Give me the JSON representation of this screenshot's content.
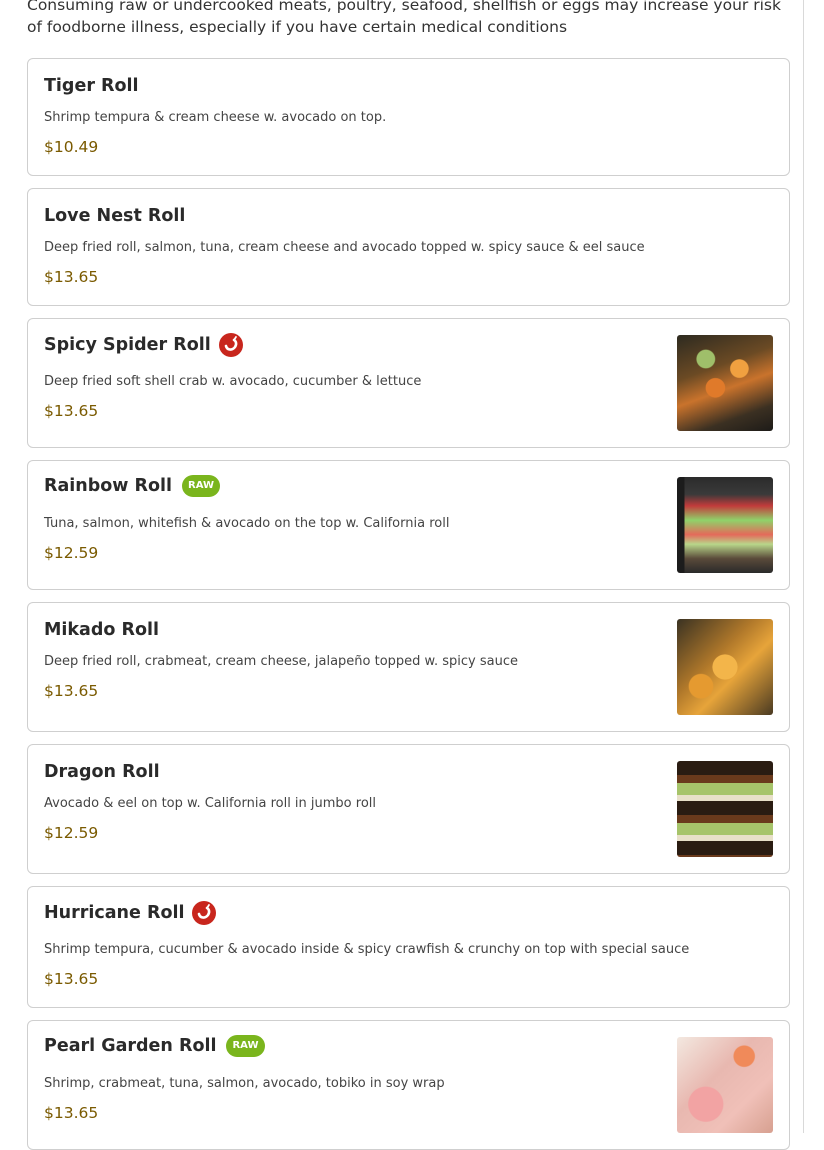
{
  "disclaimer": "Consuming raw or undercooked meats, poultry, seafood, shellfish or eggs may increase your risk of foodborne illness, especially if you have certain medical conditions",
  "badges": {
    "raw": "RAW"
  },
  "items": [
    {
      "name": "Tiger Roll",
      "description": "Shrimp tempura & cream cheese w. avocado on top.",
      "price": "$10.49"
    },
    {
      "name": "Love Nest Roll",
      "description": "Deep fried roll, salmon, tuna, cream cheese and avocado topped w. spicy sauce & eel sauce",
      "price": "$13.65"
    },
    {
      "name": "Spicy Spider Roll",
      "description": "Deep fried soft shell crab w. avocado, cucumber & lettuce",
      "price": "$13.65",
      "icon": "chili-pepper-icon"
    },
    {
      "name": "Rainbow Roll",
      "description": "Tuna, salmon, whitefish & avocado on the top w. California roll",
      "price": "$12.59",
      "badge": "RAW"
    },
    {
      "name": "Mikado Roll",
      "description": "Deep fried roll, crabmeat, cream cheese, jalapeño topped w. spicy sauce",
      "price": "$13.65"
    },
    {
      "name": "Dragon Roll",
      "description": "Avocado & eel on top w. California roll in jumbo roll",
      "price": "$12.59"
    },
    {
      "name": "Hurricane Roll",
      "description": "Shrimp tempura, cucumber & avocado inside & spicy crawfish & crunchy on top with special sauce",
      "price": "$13.65",
      "icon": "chili-pepper-icon"
    },
    {
      "name": "Pearl Garden Roll",
      "description": "Shrimp, crabmeat, tuna, salmon, avocado, tobiko in soy wrap",
      "price": "$13.65",
      "badge": "RAW"
    }
  ],
  "colors": {
    "spicy": "#c8261d",
    "raw_badge": "#7ab51d",
    "price": "#7a5a00"
  }
}
